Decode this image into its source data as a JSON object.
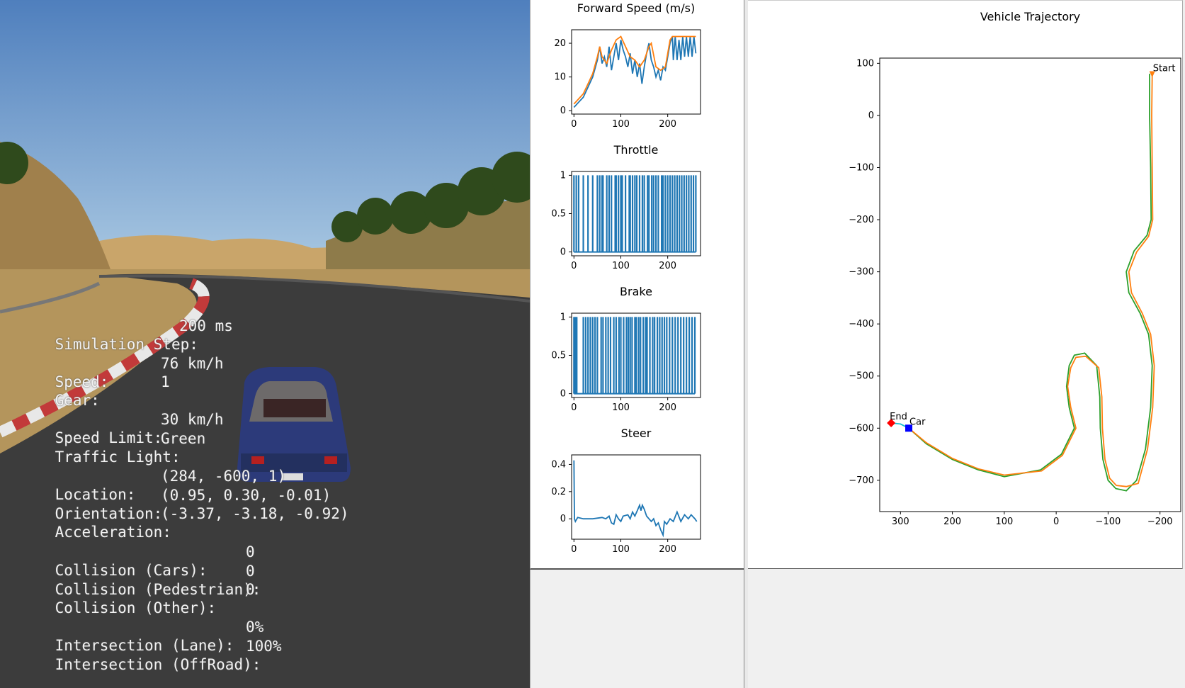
{
  "hud": {
    "sim_step_label": "Simulation Step:",
    "sim_step_value": "200 ms",
    "speed_label": "Speed:",
    "speed_value": "76 km/h",
    "gear_label": "Gear:",
    "gear_value": "1",
    "speed_limit_label": "Speed Limit:",
    "speed_limit_value": "30 km/h",
    "traffic_light_label": "Traffic Light:",
    "traffic_light_value": "Green",
    "location_label": "Location:",
    "location_value": "(284, -600, 1)",
    "orientation_label": "Orientation:",
    "orientation_value": "(0.95, 0.30, -0.01)",
    "acceleration_label": "Acceleration:",
    "acceleration_value": "(-3.37, -3.18, -0.92)",
    "collision_cars_label": "Collision (Cars):",
    "collision_cars_value": "0",
    "collision_ped_label": "Collision (Pedestrian):",
    "collision_ped_value": "0",
    "collision_other_label": "Collision (Other):",
    "collision_other_value": "0",
    "inter_lane_label": "Intersection (Lane):",
    "inter_lane_value": "0%",
    "inter_offroad_label": "Intersection (OffRoad):",
    "inter_offroad_value": "100%"
  },
  "colors": {
    "blue": "#1f77b4",
    "orange": "#ff7f0e",
    "green": "#2ca02c",
    "sky": "#5e8cc4"
  },
  "chart_data": [
    {
      "type": "line",
      "title": "Forward Speed (m/s)",
      "xlim": [
        -5,
        270
      ],
      "ylim": [
        -1,
        24
      ],
      "xticks": [
        0,
        100,
        200
      ],
      "yticks": [
        0,
        10,
        20
      ],
      "series": [
        {
          "color": "#1f77b4",
          "points": [
            [
              0,
              1
            ],
            [
              10,
              2.5
            ],
            [
              20,
              4
            ],
            [
              30,
              7
            ],
            [
              40,
              10
            ],
            [
              50,
              15
            ],
            [
              55,
              19
            ],
            [
              60,
              14
            ],
            [
              65,
              16
            ],
            [
              70,
              13
            ],
            [
              75,
              19
            ],
            [
              80,
              12
            ],
            [
              85,
              16
            ],
            [
              90,
              20
            ],
            [
              95,
              15
            ],
            [
              100,
              21
            ],
            [
              105,
              18
            ],
            [
              110,
              16
            ],
            [
              115,
              13
            ],
            [
              120,
              17
            ],
            [
              125,
              11
            ],
            [
              130,
              15
            ],
            [
              135,
              10
            ],
            [
              140,
              14
            ],
            [
              145,
              8
            ],
            [
              150,
              13
            ],
            [
              155,
              17
            ],
            [
              160,
              20
            ],
            [
              165,
              15
            ],
            [
              170,
              13
            ],
            [
              175,
              10
            ],
            [
              180,
              12
            ],
            [
              185,
              9
            ],
            [
              190,
              13
            ],
            [
              195,
              12
            ],
            [
              200,
              16
            ],
            [
              205,
              20
            ],
            [
              210,
              22
            ],
            [
              212,
              15
            ],
            [
              216,
              22
            ],
            [
              220,
              15
            ],
            [
              224,
              21
            ],
            [
              228,
              15
            ],
            [
              232,
              22
            ],
            [
              236,
              16
            ],
            [
              240,
              22
            ],
            [
              244,
              16
            ],
            [
              248,
              22
            ],
            [
              252,
              16
            ],
            [
              256,
              22
            ],
            [
              260,
              17
            ]
          ]
        },
        {
          "color": "#ff7f0e",
          "points": [
            [
              0,
              2
            ],
            [
              10,
              3.5
            ],
            [
              20,
              5
            ],
            [
              30,
              8
            ],
            [
              40,
              11
            ],
            [
              50,
              16
            ],
            [
              55,
              19
            ],
            [
              60,
              16
            ],
            [
              70,
              14
            ],
            [
              80,
              18
            ],
            [
              90,
              21
            ],
            [
              100,
              22
            ],
            [
              110,
              19
            ],
            [
              120,
              16
            ],
            [
              130,
              15
            ],
            [
              140,
              13
            ],
            [
              150,
              15
            ],
            [
              160,
              19
            ],
            [
              165,
              20
            ],
            [
              175,
              13
            ],
            [
              185,
              12
            ],
            [
              195,
              13
            ],
            [
              205,
              21
            ],
            [
              210,
              22
            ],
            [
              260,
              22
            ]
          ]
        }
      ]
    },
    {
      "type": "bar",
      "title": "Throttle",
      "xlim": [
        -5,
        270
      ],
      "ylim": [
        -0.05,
        1.05
      ],
      "xticks": [
        0,
        100,
        200
      ],
      "yticks": [
        0.0,
        0.5,
        1.0
      ],
      "spikes": [
        0,
        5,
        10,
        20,
        30,
        40,
        50,
        55,
        60,
        62,
        70,
        75,
        80,
        88,
        90,
        95,
        100,
        103,
        110,
        118,
        120,
        125,
        130,
        134,
        140,
        146,
        150,
        157,
        160,
        166,
        170,
        175,
        180,
        187,
        190,
        195,
        200,
        205,
        210,
        215,
        220,
        225,
        230,
        235,
        240,
        245,
        250,
        255,
        260
      ],
      "spike_value": 1.0
    },
    {
      "type": "bar",
      "title": "Brake",
      "xlim": [
        -5,
        270
      ],
      "ylim": [
        -0.05,
        1.05
      ],
      "xticks": [
        0,
        100,
        200
      ],
      "yticks": [
        0.0,
        0.5,
        1.0
      ],
      "spikes": [
        0,
        2,
        4,
        6,
        20,
        25,
        30,
        35,
        40,
        45,
        50,
        58,
        62,
        68,
        73,
        78,
        85,
        90,
        96,
        100,
        106,
        112,
        116,
        120,
        124,
        130,
        133,
        138,
        142,
        148,
        153,
        156,
        162,
        168,
        172,
        178,
        183,
        188,
        193,
        198,
        204,
        210,
        216,
        222,
        228,
        234,
        240,
        246,
        252,
        258
      ],
      "spike_value": 1.0
    },
    {
      "type": "line",
      "title": "Steer",
      "xlim": [
        -5,
        270
      ],
      "ylim": [
        -0.15,
        0.47
      ],
      "xticks": [
        0,
        100,
        200
      ],
      "yticks": [
        0.0,
        0.2,
        0.4
      ],
      "series": [
        {
          "color": "#1f77b4",
          "points": [
            [
              0,
              0.43
            ],
            [
              1,
              0.0
            ],
            [
              3,
              -0.02
            ],
            [
              8,
              0.01
            ],
            [
              20,
              0.0
            ],
            [
              40,
              0.0
            ],
            [
              60,
              0.01
            ],
            [
              68,
              0.0
            ],
            [
              75,
              0.02
            ],
            [
              80,
              -0.03
            ],
            [
              85,
              -0.04
            ],
            [
              90,
              0.03
            ],
            [
              95,
              0.0
            ],
            [
              100,
              -0.02
            ],
            [
              105,
              0.02
            ],
            [
              115,
              0.03
            ],
            [
              120,
              0.0
            ],
            [
              125,
              0.05
            ],
            [
              130,
              0.02
            ],
            [
              135,
              0.06
            ],
            [
              140,
              0.1
            ],
            [
              143,
              0.06
            ],
            [
              146,
              0.1
            ],
            [
              150,
              0.07
            ],
            [
              155,
              0.02
            ],
            [
              160,
              0.0
            ],
            [
              165,
              -0.02
            ],
            [
              170,
              0.0
            ],
            [
              175,
              -0.05
            ],
            [
              180,
              -0.03
            ],
            [
              185,
              -0.08
            ],
            [
              190,
              -0.12
            ],
            [
              193,
              -0.02
            ],
            [
              198,
              -0.04
            ],
            [
              205,
              0.0
            ],
            [
              212,
              -0.02
            ],
            [
              220,
              0.05
            ],
            [
              228,
              -0.02
            ],
            [
              236,
              0.03
            ],
            [
              244,
              0.0
            ],
            [
              250,
              0.03
            ],
            [
              258,
              0.0
            ],
            [
              262,
              -0.02
            ]
          ]
        }
      ]
    },
    {
      "type": "line",
      "title": "Vehicle Trajectory",
      "xlim": [
        340,
        -240
      ],
      "ylim": [
        -760,
        110
      ],
      "xticks": [
        300,
        200,
        100,
        0,
        -100,
        -200
      ],
      "yticks": [
        100,
        0,
        -100,
        -200,
        -300,
        -400,
        -500,
        -600,
        -700
      ],
      "series": [
        {
          "color": "#2ca02c",
          "points": [
            [
              -180,
              80
            ],
            [
              -180,
              0
            ],
            [
              -182,
              -100
            ],
            [
              -183,
              -200
            ],
            [
              -175,
              -230
            ],
            [
              -150,
              -260
            ],
            [
              -135,
              -300
            ],
            [
              -140,
              -340
            ],
            [
              -162,
              -380
            ],
            [
              -178,
              -420
            ],
            [
              -185,
              -480
            ],
            [
              -182,
              -560
            ],
            [
              -172,
              -640
            ],
            [
              -155,
              -700
            ],
            [
              -135,
              -720
            ],
            [
              -115,
              -716
            ],
            [
              -100,
              -700
            ],
            [
              -90,
              -660
            ],
            [
              -85,
              -600
            ],
            [
              -84,
              -540
            ],
            [
              -78,
              -480
            ],
            [
              -55,
              -456
            ],
            [
              -35,
              -460
            ],
            [
              -25,
              -480
            ],
            [
              -20,
              -520
            ],
            [
              -25,
              -560
            ],
            [
              -35,
              -600
            ],
            [
              -10,
              -650
            ],
            [
              30,
              -680
            ],
            [
              100,
              -693
            ],
            [
              150,
              -680
            ],
            [
              200,
              -660
            ],
            [
              250,
              -630
            ],
            [
              284,
              -600
            ]
          ]
        },
        {
          "color": "#ff7f0e",
          "points": [
            [
              -185,
              78
            ],
            [
              -184,
              0
            ],
            [
              -185,
              -100
            ],
            [
              -186,
              -200
            ],
            [
              -178,
              -232
            ],
            [
              -155,
              -262
            ],
            [
              -140,
              -300
            ],
            [
              -145,
              -340
            ],
            [
              -166,
              -380
            ],
            [
              -182,
              -420
            ],
            [
              -189,
              -480
            ],
            [
              -186,
              -560
            ],
            [
              -176,
              -640
            ],
            [
              -158,
              -706
            ],
            [
              -135,
              -712
            ],
            [
              -116,
              -710
            ],
            [
              -103,
              -696
            ],
            [
              -94,
              -660
            ],
            [
              -89,
              -600
            ],
            [
              -88,
              -540
            ],
            [
              -82,
              -484
            ],
            [
              -57,
              -462
            ],
            [
              -38,
              -464
            ],
            [
              -28,
              -484
            ],
            [
              -22,
              -520
            ],
            [
              -28,
              -560
            ],
            [
              -38,
              -600
            ],
            [
              -12,
              -652
            ],
            [
              28,
              -682
            ],
            [
              100,
              -690
            ],
            [
              150,
              -678
            ],
            [
              200,
              -658
            ],
            [
              250,
              -628
            ],
            [
              284,
              -600
            ]
          ]
        },
        {
          "color": "#17becf",
          "points": [
            [
              318,
              -590
            ],
            [
              300,
              -592
            ],
            [
              284,
              -600
            ]
          ]
        }
      ],
      "markers": [
        {
          "label": "Start",
          "x": -185,
          "y": 78,
          "color": "#ff7f0e",
          "shape": "triangle"
        },
        {
          "label": "End",
          "x": 318,
          "y": -590,
          "color": "#ff0000",
          "shape": "diamond"
        },
        {
          "label": "Car",
          "x": 284,
          "y": -600,
          "color": "#0000ff",
          "shape": "square"
        }
      ]
    }
  ]
}
